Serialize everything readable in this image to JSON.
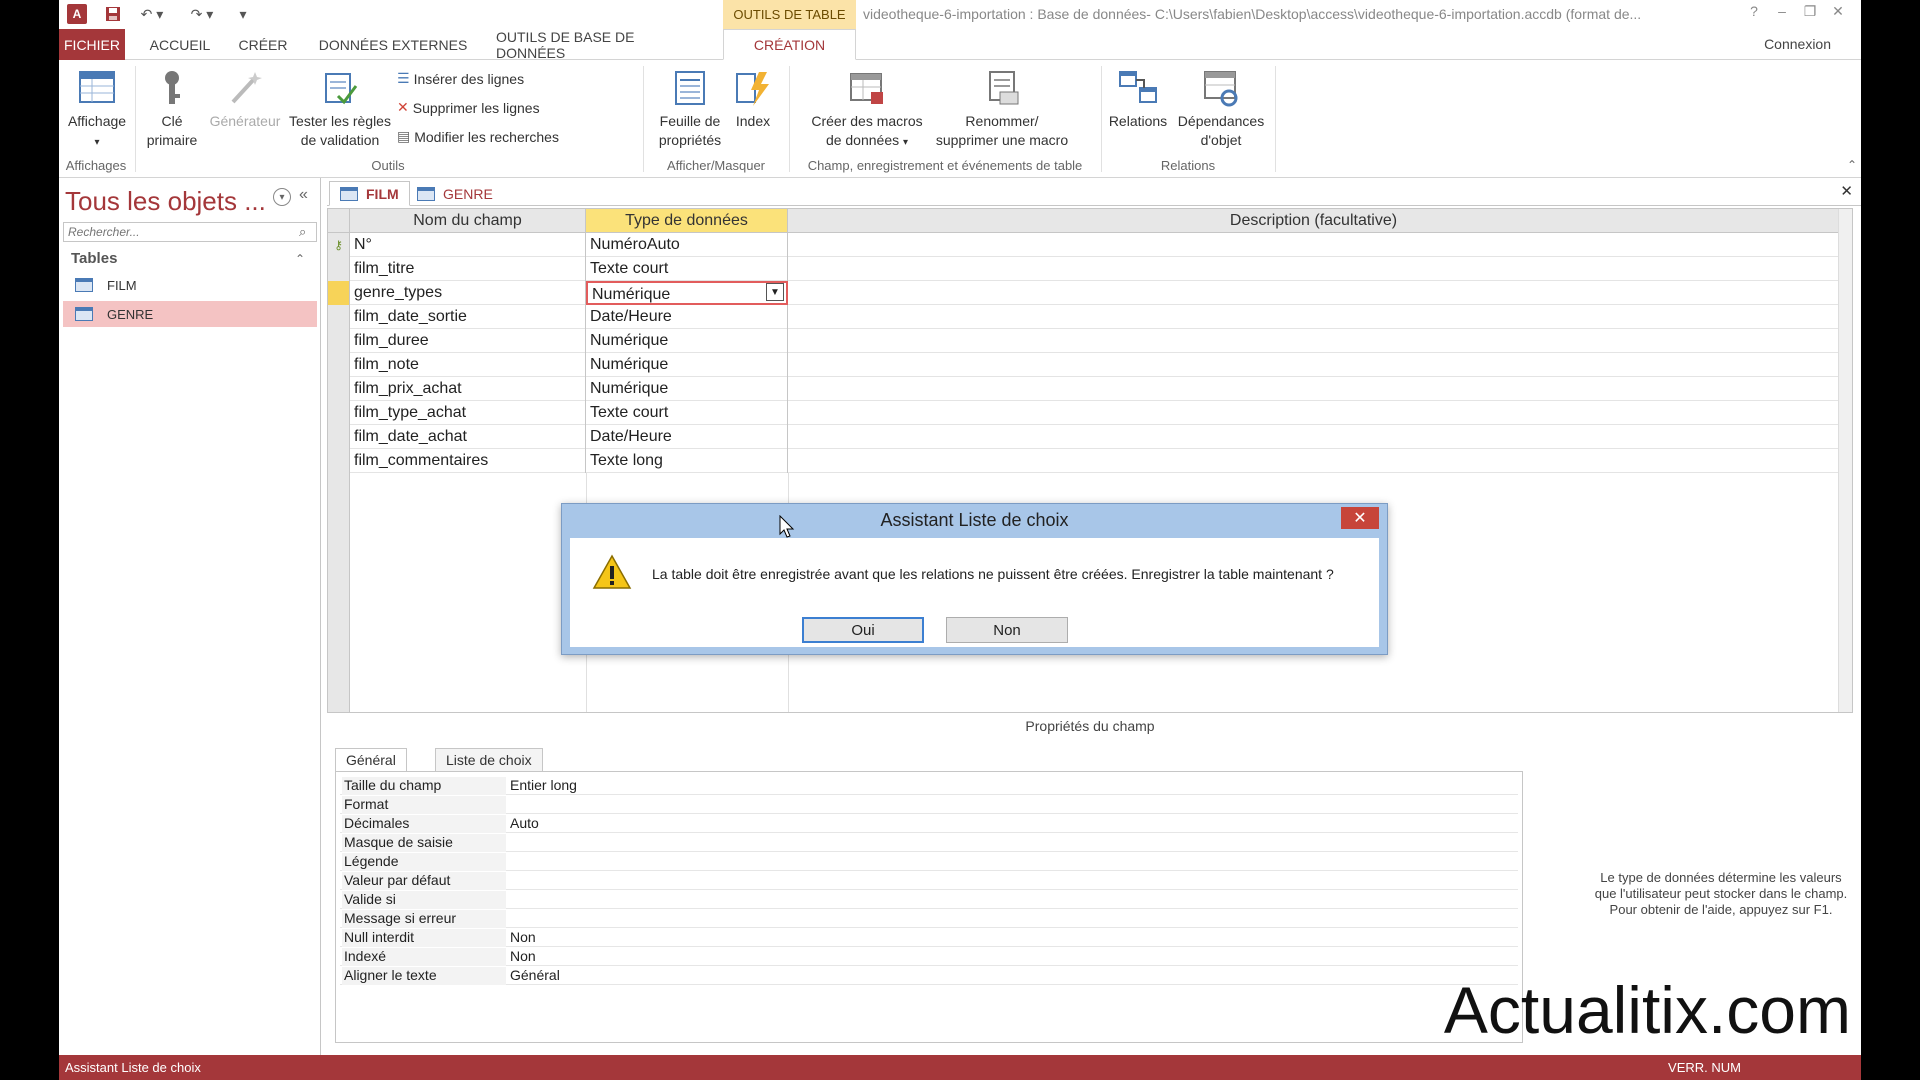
{
  "titlebar": {
    "ctx_tab": "OUTILS DE TABLE",
    "title": "videotheque-6-importation : Base de données- C:\\Users\\fabien\\Desktop\\access\\videotheque-6-importation.accdb (format de...",
    "help": "?",
    "minimize": "–",
    "restore": "❐",
    "close": "✕",
    "logo": "A"
  },
  "ribbon_tabs": [
    "FICHIER",
    "ACCUEIL",
    "CRÉER",
    "DONNÉES EXTERNES",
    "OUTILS DE BASE DE DONNÉES",
    "CRÉATION"
  ],
  "connexion": "Connexion",
  "ribbon": {
    "affichage": "Affichage",
    "cle_primaire_1": "Clé",
    "cle_primaire_2": "primaire",
    "generateur": "Générateur",
    "tester_1": "Tester les règles",
    "tester_2": "de validation",
    "inserer_lignes": "Insérer des lignes",
    "supprimer_lignes": "Supprimer les lignes",
    "modifier_recherches": "Modifier les recherches",
    "feuille_1": "Feuille de",
    "feuille_2": "propriétés",
    "index": "Index",
    "creer_macros_1": "Créer des macros",
    "creer_macros_2": "de données",
    "renommer_1": "Renommer/",
    "renommer_2": "supprimer une macro",
    "relations": "Relations",
    "dependances_1": "Dépendances",
    "dependances_2": "d'objet",
    "groups": {
      "affichages": "Affichages",
      "outils": "Outils",
      "afficher_masquer": "Afficher/Masquer",
      "champ_evenements": "Champ, enregistrement et événements de table",
      "relations": "Relations"
    }
  },
  "nav": {
    "title": "Tous les objets ...",
    "search_placeholder": "Rechercher...",
    "section": "Tables",
    "items": [
      "FILM",
      "GENRE"
    ],
    "selected": "GENRE"
  },
  "doc_tabs": [
    "FILM",
    "GENRE"
  ],
  "grid": {
    "headers": [
      "Nom du champ",
      "Type de données",
      "Description (facultative)"
    ],
    "rows": [
      {
        "name": "N°",
        "type": "NuméroAuto",
        "key": true
      },
      {
        "name": "film_titre",
        "type": "Texte court"
      },
      {
        "name": "genre_types",
        "type": "Numérique",
        "current": true
      },
      {
        "name": "film_date_sortie",
        "type": "Date/Heure"
      },
      {
        "name": "film_duree",
        "type": "Numérique"
      },
      {
        "name": "film_note",
        "type": "Numérique"
      },
      {
        "name": "film_prix_achat",
        "type": "Numérique"
      },
      {
        "name": "film_type_achat",
        "type": "Texte court"
      },
      {
        "name": "film_date_achat",
        "type": "Date/Heure"
      },
      {
        "name": "film_commentaires",
        "type": "Texte long"
      }
    ]
  },
  "properties": {
    "title": "Propriétés du champ",
    "tabs": [
      "Général",
      "Liste de choix"
    ],
    "rows": [
      {
        "label": "Taille du champ",
        "value": "Entier long"
      },
      {
        "label": "Format",
        "value": ""
      },
      {
        "label": "Décimales",
        "value": "Auto"
      },
      {
        "label": "Masque de saisie",
        "value": ""
      },
      {
        "label": "Légende",
        "value": ""
      },
      {
        "label": "Valeur par défaut",
        "value": ""
      },
      {
        "label": "Valide si",
        "value": ""
      },
      {
        "label": "Message si erreur",
        "value": ""
      },
      {
        "label": "Null interdit",
        "value": "Non"
      },
      {
        "label": "Indexé",
        "value": "Non"
      },
      {
        "label": "Aligner le texte",
        "value": "Général"
      }
    ],
    "help": "Le type de données détermine les valeurs que l'utilisateur peut stocker dans le champ. Pour obtenir de l'aide, appuyez sur F1."
  },
  "dialog": {
    "title": "Assistant Liste de choix",
    "message": "La table doit être enregistrée avant que les relations ne puissent être créées. Enregistrer la table maintenant ?",
    "yes": "Oui",
    "no": "Non"
  },
  "status": {
    "left": "Assistant Liste de choix",
    "right": "VERR. NUM"
  },
  "watermark": "Actualitix.com",
  "colors": {
    "accent": "#a4373a",
    "context_tab": "#fbe3a8",
    "type_header": "#fbe27a",
    "selected_nav": "#f4c3c3",
    "dialog_frame": "#a8c6e8"
  }
}
